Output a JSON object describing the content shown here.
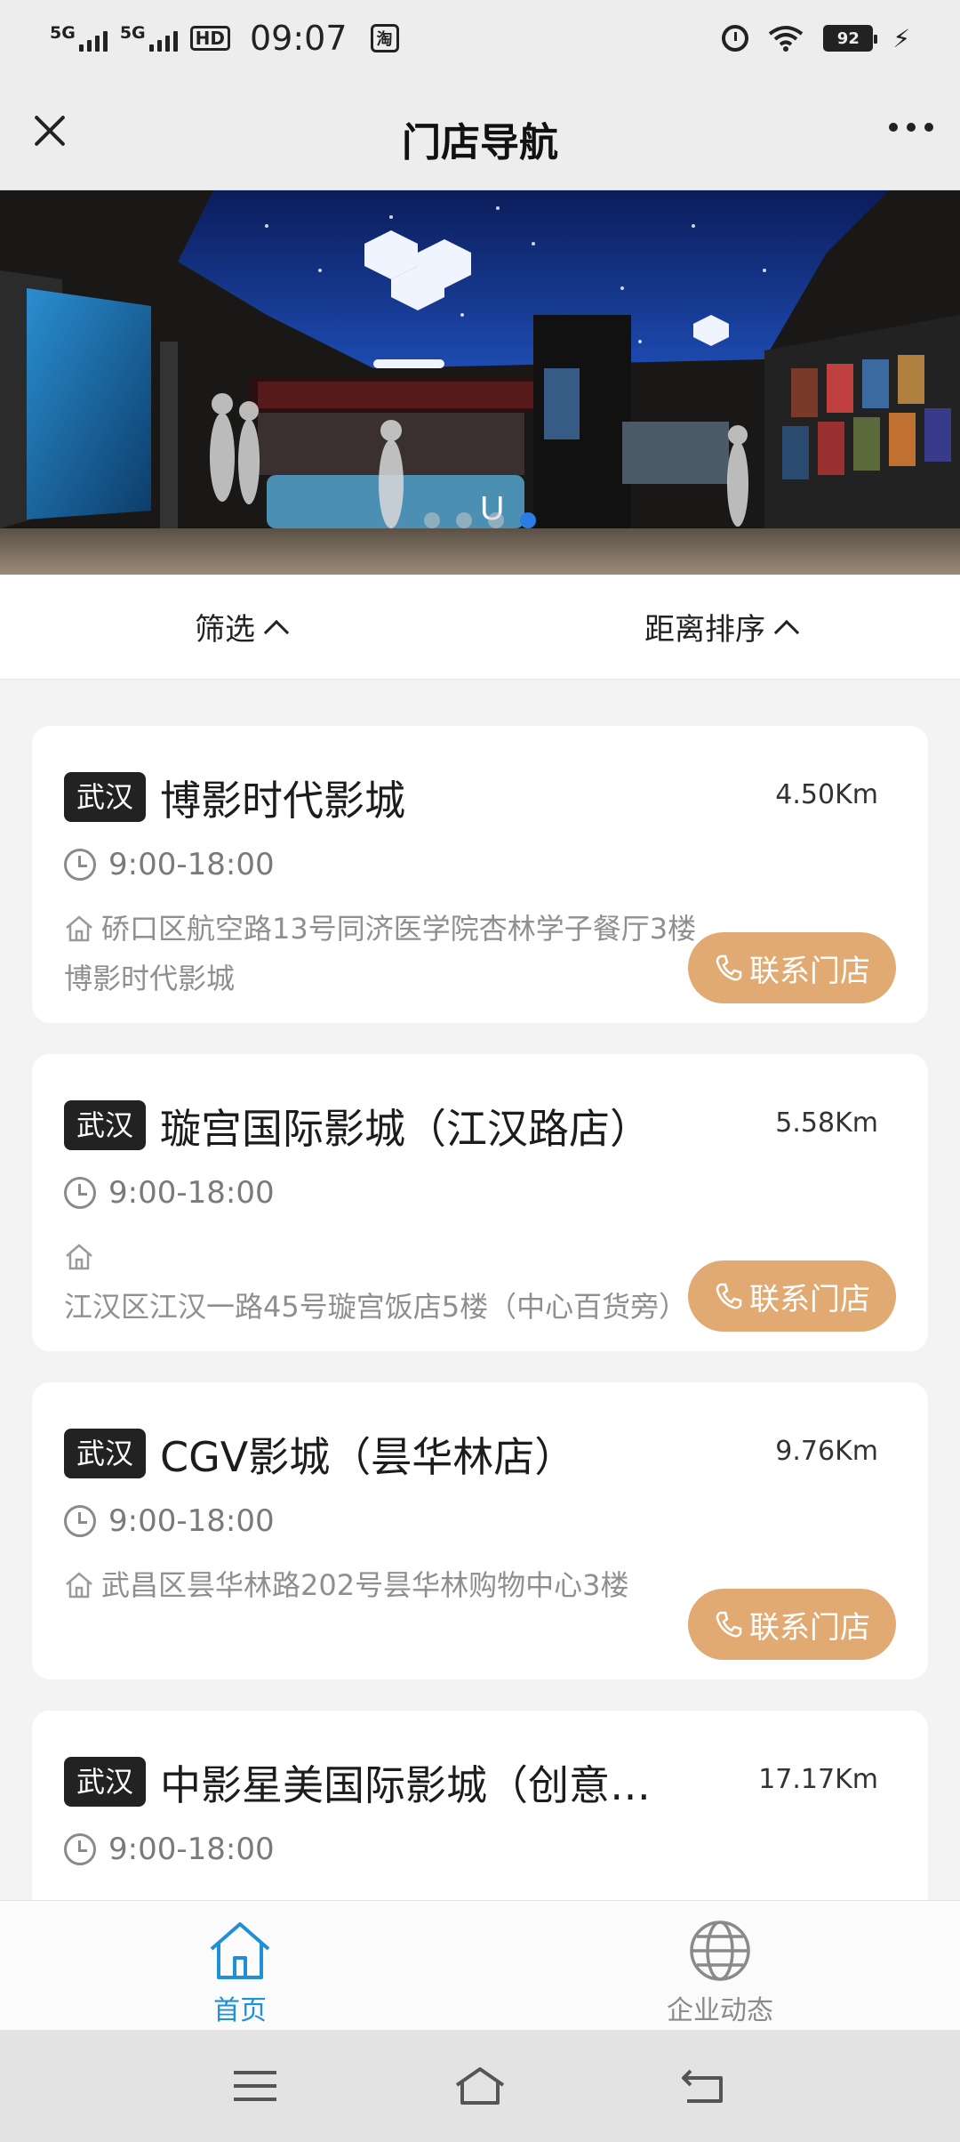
{
  "status_bar": {
    "signal1": "5G",
    "signal2": "5G",
    "hd": "HD",
    "time": "09:07",
    "app_icon": "淘",
    "battery": "92"
  },
  "nav": {
    "title": "门店导航"
  },
  "banner": {
    "sign_text": "U"
  },
  "filter": {
    "filter_label": "筛选",
    "sort_label": "距离排序"
  },
  "stores": [
    {
      "city": "武汉",
      "name": "博影时代影城",
      "distance": "4.50Km",
      "hours": "9:00-18:00",
      "address": "硚口区航空路13号同济医学院杏林学子餐厅3楼博影时代影城",
      "contact": "联系门店"
    },
    {
      "city": "武汉",
      "name": "璇宫国际影城（江汉路店）",
      "distance": "5.58Km",
      "hours": "9:00-18:00",
      "address": "江汉区江汉一路45号璇宫饭店5楼（中心百货旁）",
      "contact": "联系门店"
    },
    {
      "city": "武汉",
      "name": "CGV影城（昙华林店）",
      "distance": "9.76Km",
      "hours": "9:00-18:00",
      "address": "武昌区昙华林路202号昙华林购物中心3楼",
      "contact": "联系门店"
    },
    {
      "city": "武汉",
      "name": "中影星美国际影城（创意…",
      "distance": "17.17Km",
      "hours": "9:00-18:00"
    }
  ],
  "tabs": {
    "home": "首页",
    "news": "企业动态"
  },
  "colors": {
    "accent_gold": "#e0aa72",
    "tab_active": "#1f8fd6",
    "tag_bg": "#222222"
  }
}
